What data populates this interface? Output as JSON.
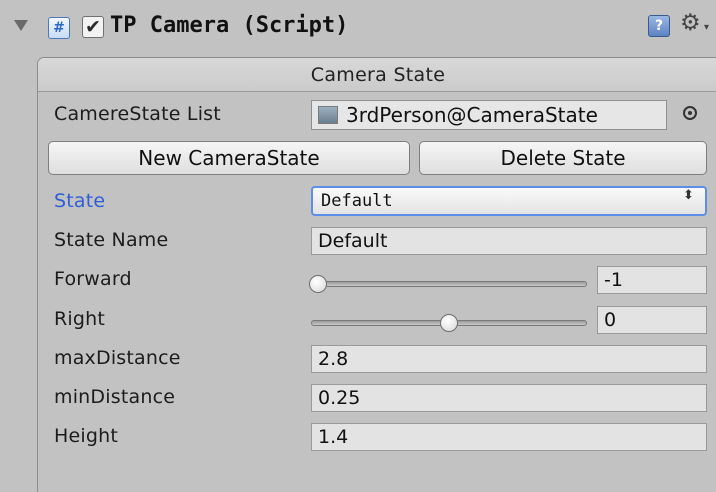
{
  "component": {
    "title": "TP Camera (Script)",
    "enabled_check": "✔",
    "script_icon_glyph": "#",
    "help_glyph": "?",
    "gear_glyph": "⚙",
    "gear_caret": "▾"
  },
  "section": {
    "title": "Camera State"
  },
  "camera_state_list": {
    "label": "CamereState List",
    "value": "3rdPerson@CameraState"
  },
  "buttons": {
    "new_state": "New CameraState",
    "delete_state": "Delete State"
  },
  "state": {
    "label": "State",
    "selected": "Default",
    "arrow": "⬍"
  },
  "state_name": {
    "label": "State Name",
    "value": "Default"
  },
  "forward": {
    "label": "Forward",
    "value": "-1",
    "min": -1,
    "max": 1,
    "slider_fraction": 0.0
  },
  "right": {
    "label": "Right",
    "value": "0",
    "min": -1,
    "max": 1,
    "slider_fraction": 0.5
  },
  "max_distance": {
    "label": "maxDistance",
    "value": "2.8"
  },
  "min_distance": {
    "label": "minDistance",
    "value": "0.25"
  },
  "height": {
    "label": "Height",
    "value": "1.4"
  },
  "colors": {
    "active_label": "#2f5fd6",
    "background": "#c2c2c2",
    "field": "#e3e3e3"
  }
}
